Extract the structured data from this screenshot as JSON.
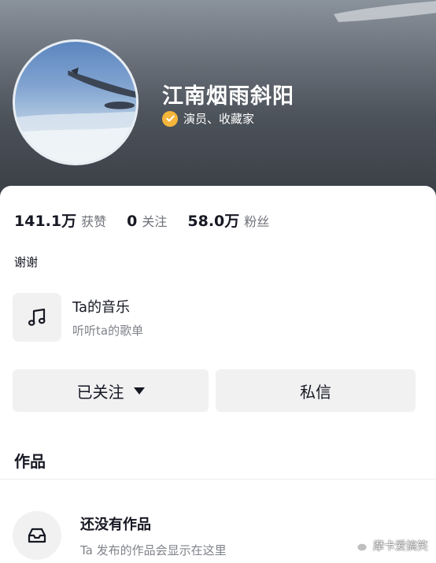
{
  "profile": {
    "nickname": "江南烟雨斜阳",
    "verification": "演员、收藏家"
  },
  "stats": [
    {
      "value": "141.1万",
      "label": "获赞"
    },
    {
      "value": "0",
      "label": "关注"
    },
    {
      "value": "58.0万",
      "label": "粉丝"
    }
  ],
  "bio": "谢谢",
  "music": {
    "title": "Ta的音乐",
    "subtitle": "听听ta的歌单",
    "icon": "music-note-icon"
  },
  "actions": {
    "follow_label": "已关注",
    "message_label": "私信"
  },
  "works": {
    "title": "作品",
    "empty_title": "还没有作品",
    "empty_subtitle": "Ta 发布的作品会显示在这里",
    "empty_icon": "inbox-icon"
  },
  "watermark": {
    "text": "摩卡爱搞笑",
    "icon": "wechat-icon"
  },
  "colors": {
    "verify_badge": "#f5b53b",
    "button_bg": "#f1f1f2",
    "text_primary": "#161823",
    "text_secondary": "#80838a"
  }
}
